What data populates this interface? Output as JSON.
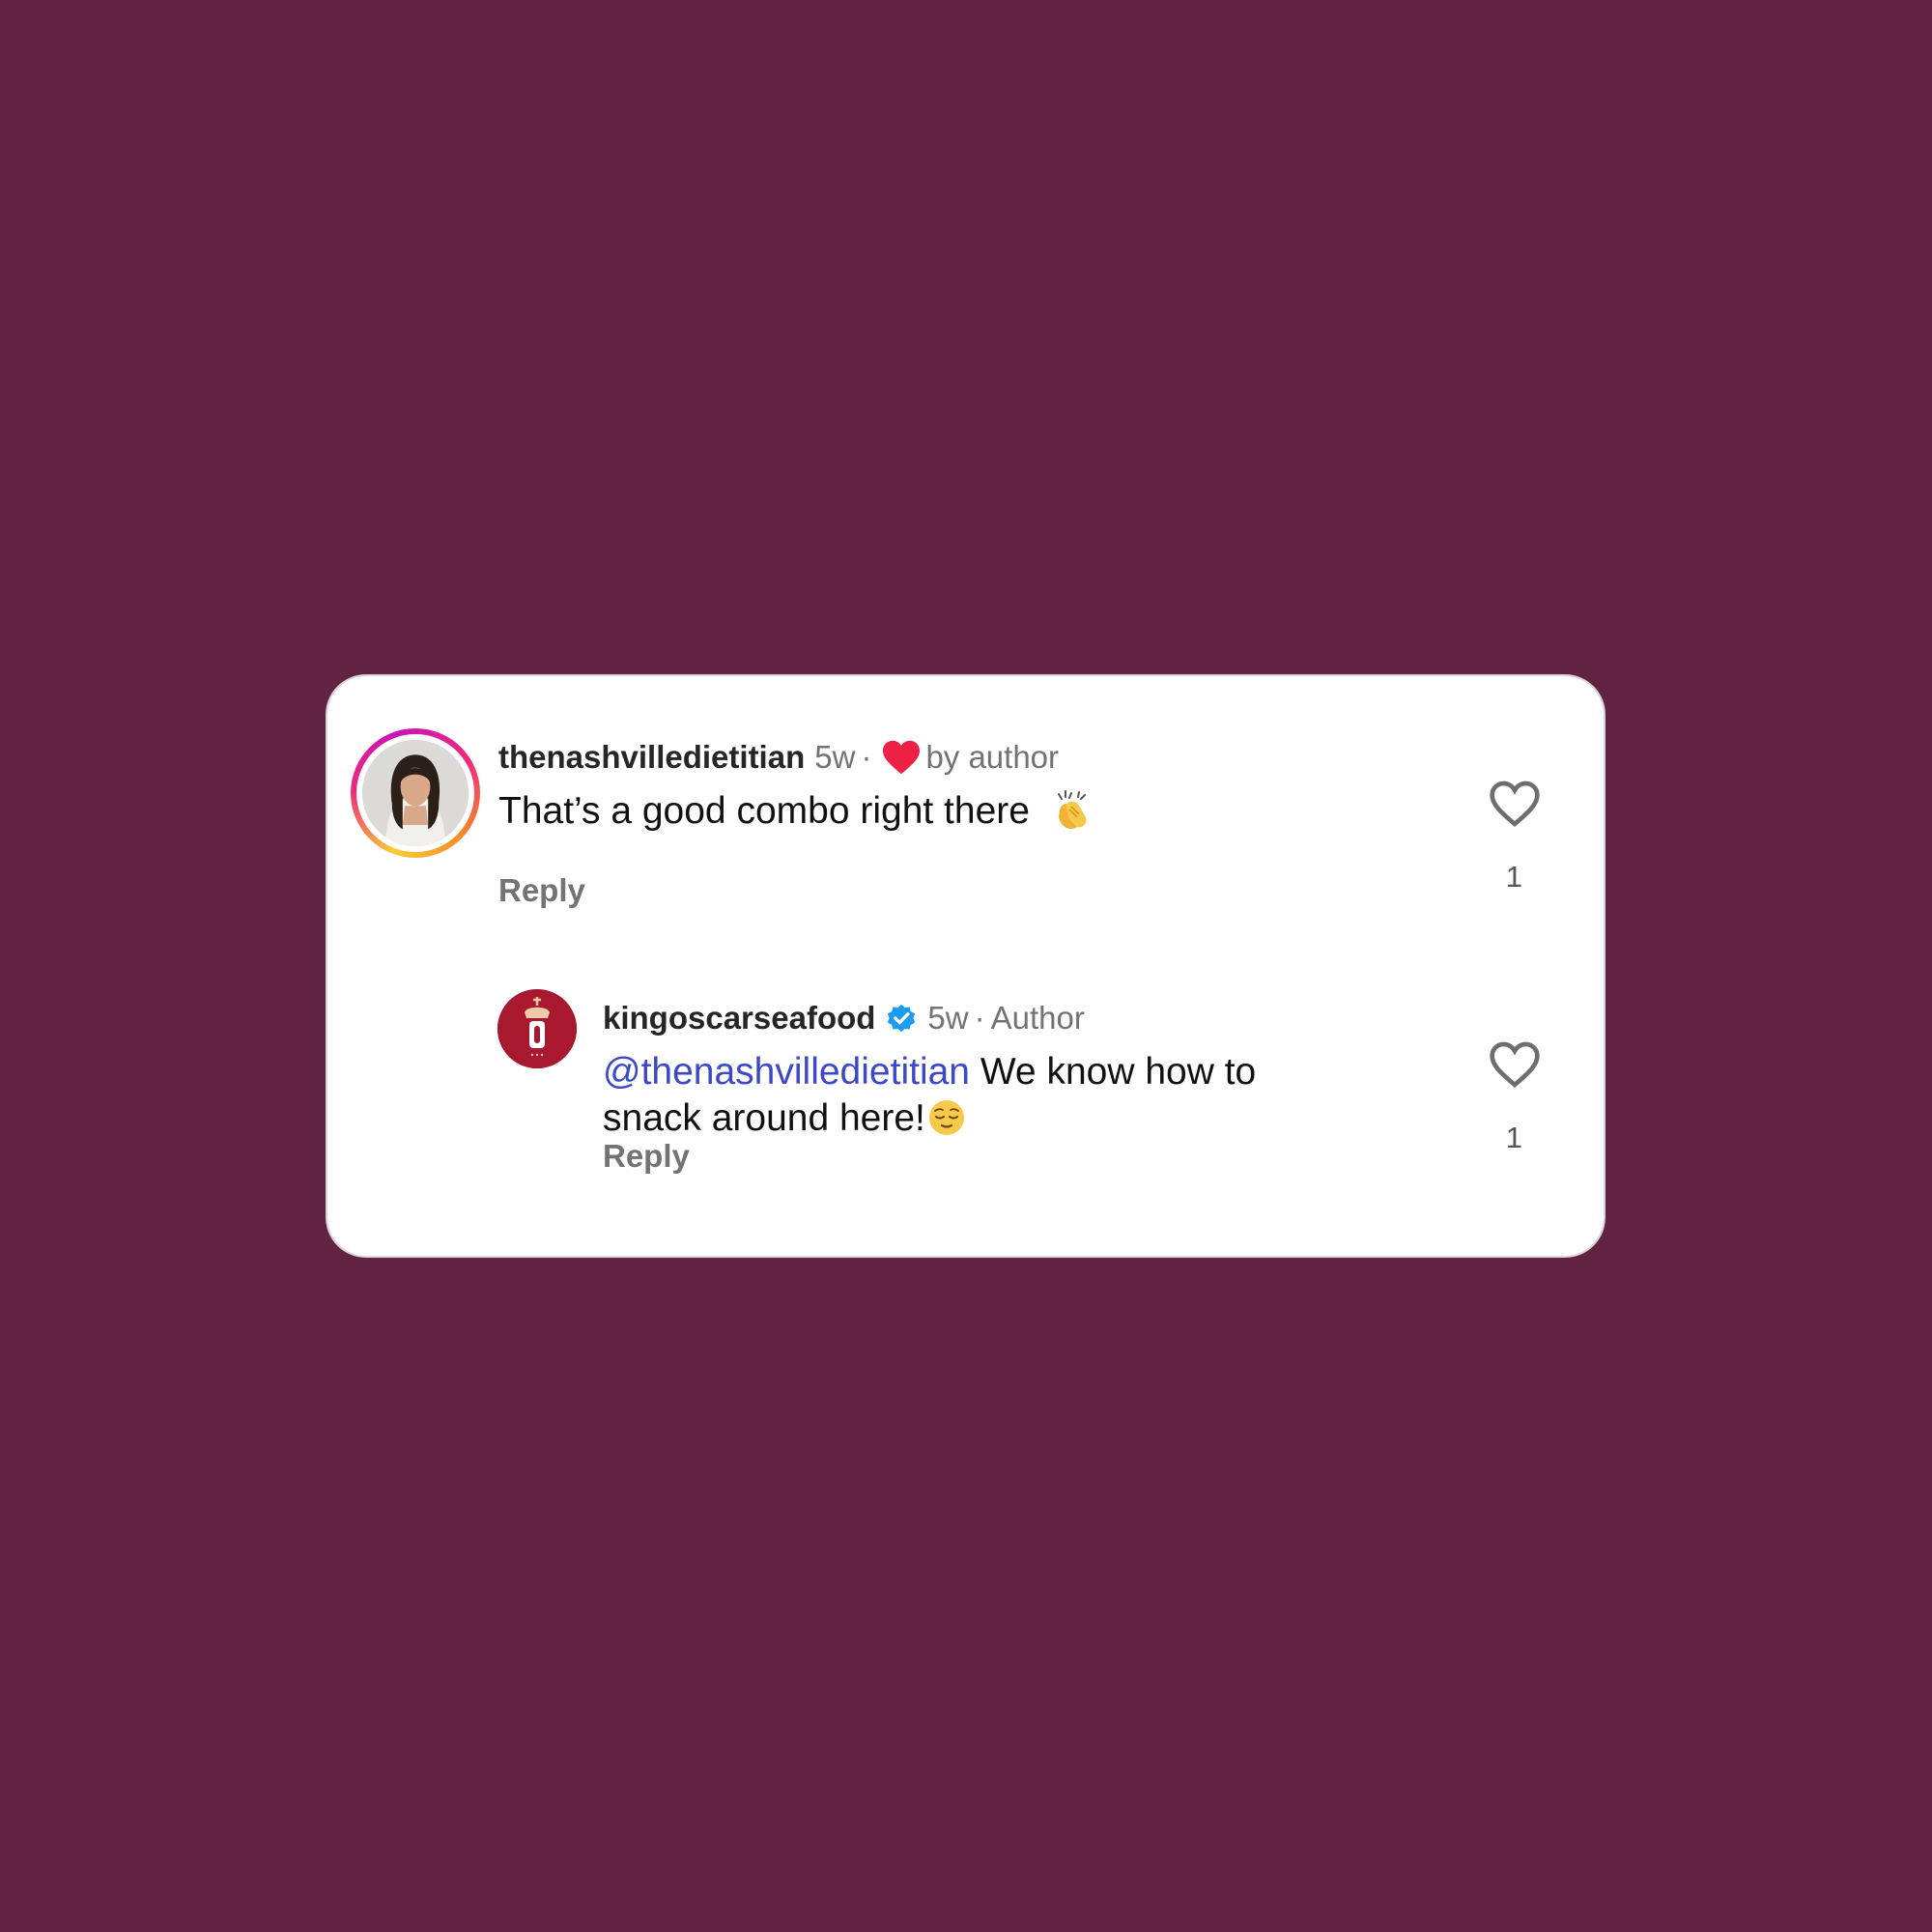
{
  "colors": {
    "background": "#622241",
    "card": "#ffffff",
    "mention": "#3b49c7",
    "heart_red": "#ed2143",
    "verified_blue": "#1d9bf0",
    "logo_red": "#a8182e"
  },
  "comments": [
    {
      "username": "thenashvilledietitian",
      "time": "5w",
      "separator": "·",
      "liked_by_author_label": "by author",
      "liked_by_author_icon": "red-heart-icon",
      "text": "That’s a good combo right there",
      "emoji": "clapping-hands-emoji",
      "reply_label": "Reply",
      "like_icon": "heart-outline-icon",
      "like_count": "1",
      "avatar": "profile-photo"
    },
    {
      "username": "kingoscarseafood",
      "verified_icon": "verified-badge-icon",
      "time": "5w",
      "separator": "·",
      "role_label": "Author",
      "mention": "@thenashvilledietitian",
      "text": " We know how to snack around here!",
      "emoji": "relieved-face-emoji",
      "reply_label": "Reply",
      "like_icon": "heart-outline-icon",
      "like_count": "1",
      "avatar": "king-oscar-logo"
    }
  ]
}
